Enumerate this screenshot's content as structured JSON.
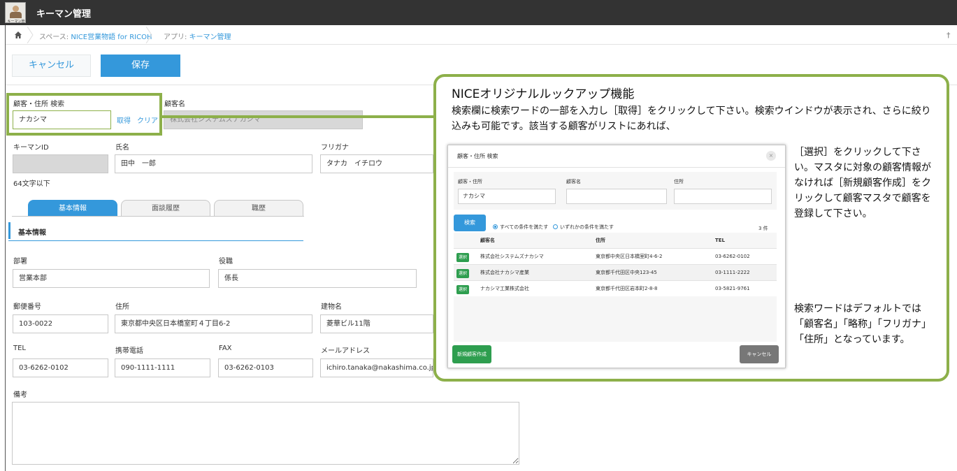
{
  "app": {
    "title": "キーマン管理",
    "logo_caption": "キーマン管理"
  },
  "breadcrumb": {
    "space_prefix": "スペース: ",
    "space_name": "NICE営業物語 for RICOH",
    "app_prefix": "アプリ: ",
    "app_name": "キーマン管理"
  },
  "icons": {
    "home": "home-icon",
    "pin": "pin-icon",
    "close": "close-icon"
  },
  "toolbar": {
    "cancel_label": "キャンセル",
    "save_label": "保存"
  },
  "form": {
    "lookup_label": "顧客・住所 検索",
    "lookup_value": "ナカシマ",
    "lookup_get": "取得",
    "lookup_clear": "クリア",
    "customer_label": "顧客名",
    "customer_value": "株式会社システムズナカシマ",
    "keyman_id_label": "キーマンID",
    "keyman_id_hint": "64文字以下",
    "name_label": "氏名",
    "name_value": "田中　一郎",
    "kana_label": "フリガナ",
    "kana_value": "タナカ　イチロウ",
    "tabs": [
      "基本情報",
      "面談履歴",
      "職歴"
    ],
    "section_title": "基本情報",
    "dept_label": "部署",
    "dept_value": "営業本部",
    "position_label": "役職",
    "position_value": "係長",
    "zip_label": "郵便番号",
    "zip_value": "103-0022",
    "address_label": "住所",
    "address_value": "東京都中央区日本橋室町４丁目6-2",
    "building_label": "建物名",
    "building_value": "菱華ビル11階",
    "tel_label": "TEL",
    "tel_value": "03-6262-0102",
    "mobile_label": "携帯電話",
    "mobile_value": "090-1111-1111",
    "fax_label": "FAX",
    "fax_value": "03-6262-0103",
    "email_label": "メールアドレス",
    "email_value": "ichiro.tanaka@nakashima.co.jp",
    "memo_label": "備考"
  },
  "callout": {
    "title": "NICEオリジナルルックアップ機能",
    "body1": "検索欄に検索ワードの一部を入力し［取得］をクリックして下さい。検索ウインドウが表示され、さらに絞り込みも可能です。該当する顧客がリストにあれば、",
    "body2": "［選択］をクリックして下さい。マスタに対象の顧客情報がなければ［新規顧客作成］をクリックして顧客マスタで顧客を登録して下さい。",
    "body3": "検索ワードはデフォルトでは「顧客名」「略称」「フリガナ」「住所」となっています。"
  },
  "modal": {
    "title": "顧客・住所 検索",
    "close_glyph": "×",
    "lookup_label": "顧客・住所",
    "lookup_value": "ナカシマ",
    "name_label": "顧客名",
    "address_label": "住所",
    "search_button": "検索",
    "radio_all": "すべての条件を満たす",
    "radio_any": "いずれかの条件を満たす",
    "count": "3 件",
    "columns": [
      "顧客名",
      "住所",
      "TEL"
    ],
    "select_label": "選択",
    "rows": [
      {
        "name": "株式会社システムズナカシマ",
        "address": "東京都中央区日本橋室町4-6-2",
        "tel": "03-6262-0102"
      },
      {
        "name": "株式会社ナカシマ産業",
        "address": "東京都千代田区中央123-45",
        "tel": "03-1111-2222"
      },
      {
        "name": "ナカシマ工業株式会社",
        "address": "東京都千代田区岩本町2-8-8",
        "tel": "03-5821-9761"
      }
    ],
    "new_button": "新規顧客作成",
    "cancel_button": "キャンセル"
  }
}
